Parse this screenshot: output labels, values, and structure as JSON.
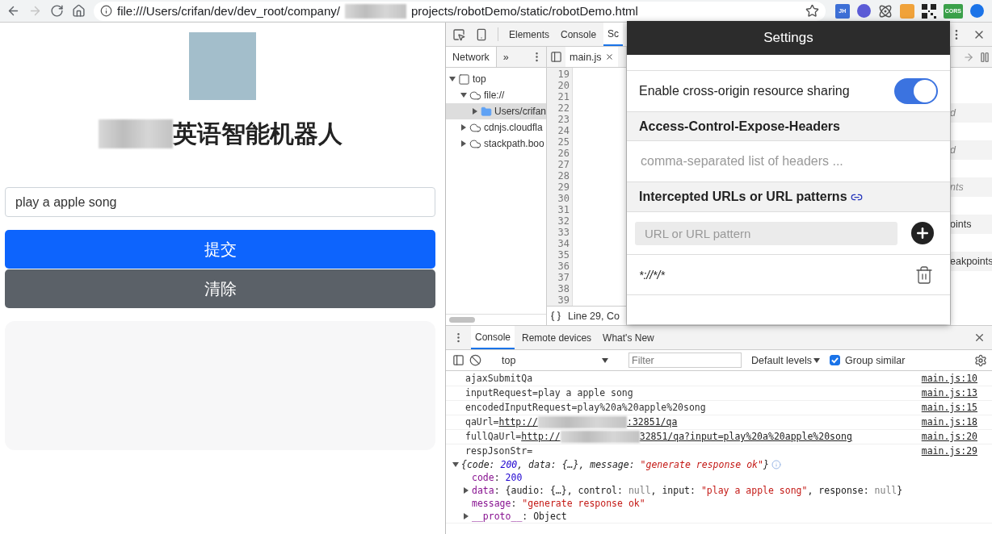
{
  "browser": {
    "nav": [
      {
        "kind": "back",
        "disabled": false
      },
      {
        "kind": "forward",
        "disabled": true
      },
      {
        "kind": "reload",
        "disabled": false
      },
      {
        "kind": "home",
        "disabled": false
      }
    ],
    "url": [
      "file:///Users/crifan/dev/dev_root/company/",
      "projects/robotDemo/static/robotDemo.html"
    ],
    "extensions": [
      {
        "kind": "badge",
        "label": "JH",
        "color": "#3d6fd6"
      },
      {
        "kind": "orb",
        "color": "#5b5bd6"
      },
      {
        "kind": "atom",
        "color": "#555555"
      },
      {
        "kind": "tile",
        "color": "#f0a23a"
      },
      {
        "kind": "qr",
        "color": "#222222"
      },
      {
        "kind": "badge",
        "label": "CORS",
        "color": "#3aa04a"
      },
      {
        "kind": "orb",
        "color": "#1a73e8"
      }
    ]
  },
  "page": {
    "title": "英语智能机器人",
    "input_value": "play a apple song",
    "buttons": [
      {
        "label": "提交",
        "kind": "primary"
      },
      {
        "label": "清除",
        "kind": "secondary"
      }
    ]
  },
  "devtools": {
    "tabs": [
      {
        "label": "Elements",
        "selected": false
      },
      {
        "label": "Console",
        "selected": false
      },
      {
        "label": "Sc",
        "selected": true
      }
    ],
    "navigator": {
      "tabs": [
        {
          "label": "Network",
          "selected": true
        },
        {
          "label": "»",
          "selected": false
        }
      ],
      "tree": [
        {
          "label": "top",
          "kind": "frame",
          "expanded": true,
          "selected": false,
          "children": [
            {
              "label": "file://",
              "kind": "domain",
              "expanded": true,
              "selected": false,
              "children": [
                {
                  "label": "Users/crifan",
                  "kind": "folder",
                  "expanded": false,
                  "selected": true
                }
              ]
            },
            {
              "label": "cdnjs.cloudfla",
              "kind": "domain",
              "expanded": false,
              "selected": false
            },
            {
              "label": "stackpath.boo",
              "kind": "domain",
              "expanded": false,
              "selected": false
            }
          ]
        }
      ]
    },
    "editor": {
      "file_tab": "main.js",
      "line_numbers": [
        "19",
        "20",
        "21",
        "22",
        "23",
        "24",
        "25",
        "26",
        "27",
        "28",
        "29",
        "30",
        "31",
        "32",
        "33",
        "34",
        "35",
        "36",
        "37",
        "38",
        "39"
      ],
      "status": "Line 29, Co"
    },
    "sidebar_fragments": [
      {
        "text": "d",
        "italic": true
      },
      {
        "text": "d",
        "italic": true
      },
      {
        "text": "nts",
        "italic": true
      },
      {
        "text": "oints",
        "italic": false
      },
      {
        "text": "eakpoints",
        "italic": false
      }
    ]
  },
  "console_drawer": {
    "tabs": [
      {
        "label": "Console",
        "selected": true
      },
      {
        "label": "Remote devices",
        "selected": false
      },
      {
        "label": "What's New",
        "selected": false
      }
    ],
    "context": "top",
    "filter_placeholder": "Filter",
    "levels": "Default levels",
    "group_similar": {
      "label": "Group similar",
      "checked": true
    },
    "messages": [
      {
        "text": "ajaxSubmitQa",
        "source": "main.js:10"
      },
      {
        "text": "inputRequest=play a apple song",
        "source": "main.js:13"
      },
      {
        "text": "encodedInputRequest=play%20a%20apple%20song",
        "source": "main.js:15"
      },
      {
        "text": "qaUrl=",
        "link": [
          "http://",
          ":32851/qa"
        ],
        "source": "main.js:18"
      },
      {
        "text": "fullQaUrl=",
        "link": [
          "http://",
          "32851/qa?input=play%20a%20apple%20song"
        ],
        "source": "main.js:20"
      },
      {
        "text": "respJsonStr=",
        "source": "main.js:29",
        "object": {
          "expanded": true,
          "summary": [
            {
              "kind": "plain",
              "t": "{code: "
            },
            {
              "kind": "num",
              "t": "200"
            },
            {
              "kind": "plain",
              "t": ", data: {…}, message: "
            },
            {
              "kind": "str",
              "t": "\"generate response ok\""
            },
            {
              "kind": "plain",
              "t": "}"
            }
          ],
          "children": [
            {
              "segments": [
                {
                  "kind": "key",
                  "t": "code"
                },
                {
                  "kind": "plain",
                  "t": ": "
                },
                {
                  "kind": "num",
                  "t": "200"
                }
              ]
            },
            {
              "expanded": false,
              "segments": [
                {
                  "kind": "key",
                  "t": "data"
                },
                {
                  "kind": "plain",
                  "t": ": {audio: {…}, control: "
                },
                {
                  "kind": "null",
                  "t": "null"
                },
                {
                  "kind": "plain",
                  "t": ", input: "
                },
                {
                  "kind": "str",
                  "t": "\"play a apple song\""
                },
                {
                  "kind": "plain",
                  "t": ", response: "
                },
                {
                  "kind": "null",
                  "t": "null"
                },
                {
                  "kind": "plain",
                  "t": "}"
                }
              ]
            },
            {
              "segments": [
                {
                  "kind": "key",
                  "t": "message"
                },
                {
                  "kind": "plain",
                  "t": ": "
                },
                {
                  "kind": "str",
                  "t": "\"generate response ok\""
                }
              ]
            },
            {
              "expanded": false,
              "segments": [
                {
                  "kind": "key",
                  "t": "__proto__"
                },
                {
                  "kind": "plain",
                  "t": ": Object"
                }
              ]
            }
          ]
        }
      }
    ]
  },
  "cors_settings": {
    "title": "Settings",
    "toggle": {
      "label": "Enable cross-origin resource sharing",
      "on": true
    },
    "expose_headers": {
      "heading": "Access-Control-Expose-Headers",
      "placeholder": "comma-separated list of headers ..."
    },
    "intercepted": {
      "heading": "Intercepted URLs or URL patterns",
      "placeholder": "URL or URL pattern",
      "patterns": [
        "*://*/*"
      ]
    }
  }
}
